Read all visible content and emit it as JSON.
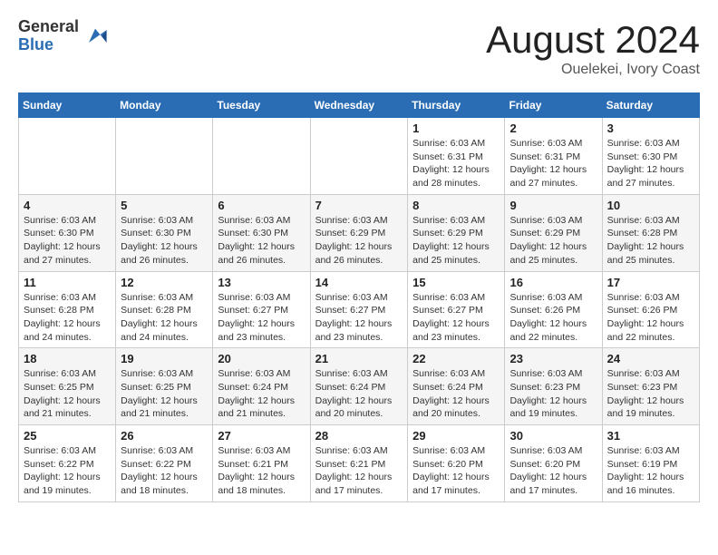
{
  "header": {
    "logo_general": "General",
    "logo_blue": "Blue",
    "month_title": "August 2024",
    "location": "Ouelekei, Ivory Coast"
  },
  "days_of_week": [
    "Sunday",
    "Monday",
    "Tuesday",
    "Wednesday",
    "Thursday",
    "Friday",
    "Saturday"
  ],
  "weeks": [
    [
      {
        "day": "",
        "info": ""
      },
      {
        "day": "",
        "info": ""
      },
      {
        "day": "",
        "info": ""
      },
      {
        "day": "",
        "info": ""
      },
      {
        "day": "1",
        "info": "Sunrise: 6:03 AM\nSunset: 6:31 PM\nDaylight: 12 hours\nand 28 minutes."
      },
      {
        "day": "2",
        "info": "Sunrise: 6:03 AM\nSunset: 6:31 PM\nDaylight: 12 hours\nand 27 minutes."
      },
      {
        "day": "3",
        "info": "Sunrise: 6:03 AM\nSunset: 6:30 PM\nDaylight: 12 hours\nand 27 minutes."
      }
    ],
    [
      {
        "day": "4",
        "info": "Sunrise: 6:03 AM\nSunset: 6:30 PM\nDaylight: 12 hours\nand 27 minutes."
      },
      {
        "day": "5",
        "info": "Sunrise: 6:03 AM\nSunset: 6:30 PM\nDaylight: 12 hours\nand 26 minutes."
      },
      {
        "day": "6",
        "info": "Sunrise: 6:03 AM\nSunset: 6:30 PM\nDaylight: 12 hours\nand 26 minutes."
      },
      {
        "day": "7",
        "info": "Sunrise: 6:03 AM\nSunset: 6:29 PM\nDaylight: 12 hours\nand 26 minutes."
      },
      {
        "day": "8",
        "info": "Sunrise: 6:03 AM\nSunset: 6:29 PM\nDaylight: 12 hours\nand 25 minutes."
      },
      {
        "day": "9",
        "info": "Sunrise: 6:03 AM\nSunset: 6:29 PM\nDaylight: 12 hours\nand 25 minutes."
      },
      {
        "day": "10",
        "info": "Sunrise: 6:03 AM\nSunset: 6:28 PM\nDaylight: 12 hours\nand 25 minutes."
      }
    ],
    [
      {
        "day": "11",
        "info": "Sunrise: 6:03 AM\nSunset: 6:28 PM\nDaylight: 12 hours\nand 24 minutes."
      },
      {
        "day": "12",
        "info": "Sunrise: 6:03 AM\nSunset: 6:28 PM\nDaylight: 12 hours\nand 24 minutes."
      },
      {
        "day": "13",
        "info": "Sunrise: 6:03 AM\nSunset: 6:27 PM\nDaylight: 12 hours\nand 23 minutes."
      },
      {
        "day": "14",
        "info": "Sunrise: 6:03 AM\nSunset: 6:27 PM\nDaylight: 12 hours\nand 23 minutes."
      },
      {
        "day": "15",
        "info": "Sunrise: 6:03 AM\nSunset: 6:27 PM\nDaylight: 12 hours\nand 23 minutes."
      },
      {
        "day": "16",
        "info": "Sunrise: 6:03 AM\nSunset: 6:26 PM\nDaylight: 12 hours\nand 22 minutes."
      },
      {
        "day": "17",
        "info": "Sunrise: 6:03 AM\nSunset: 6:26 PM\nDaylight: 12 hours\nand 22 minutes."
      }
    ],
    [
      {
        "day": "18",
        "info": "Sunrise: 6:03 AM\nSunset: 6:25 PM\nDaylight: 12 hours\nand 21 minutes."
      },
      {
        "day": "19",
        "info": "Sunrise: 6:03 AM\nSunset: 6:25 PM\nDaylight: 12 hours\nand 21 minutes."
      },
      {
        "day": "20",
        "info": "Sunrise: 6:03 AM\nSunset: 6:24 PM\nDaylight: 12 hours\nand 21 minutes."
      },
      {
        "day": "21",
        "info": "Sunrise: 6:03 AM\nSunset: 6:24 PM\nDaylight: 12 hours\nand 20 minutes."
      },
      {
        "day": "22",
        "info": "Sunrise: 6:03 AM\nSunset: 6:24 PM\nDaylight: 12 hours\nand 20 minutes."
      },
      {
        "day": "23",
        "info": "Sunrise: 6:03 AM\nSunset: 6:23 PM\nDaylight: 12 hours\nand 19 minutes."
      },
      {
        "day": "24",
        "info": "Sunrise: 6:03 AM\nSunset: 6:23 PM\nDaylight: 12 hours\nand 19 minutes."
      }
    ],
    [
      {
        "day": "25",
        "info": "Sunrise: 6:03 AM\nSunset: 6:22 PM\nDaylight: 12 hours\nand 19 minutes."
      },
      {
        "day": "26",
        "info": "Sunrise: 6:03 AM\nSunset: 6:22 PM\nDaylight: 12 hours\nand 18 minutes."
      },
      {
        "day": "27",
        "info": "Sunrise: 6:03 AM\nSunset: 6:21 PM\nDaylight: 12 hours\nand 18 minutes."
      },
      {
        "day": "28",
        "info": "Sunrise: 6:03 AM\nSunset: 6:21 PM\nDaylight: 12 hours\nand 17 minutes."
      },
      {
        "day": "29",
        "info": "Sunrise: 6:03 AM\nSunset: 6:20 PM\nDaylight: 12 hours\nand 17 minutes."
      },
      {
        "day": "30",
        "info": "Sunrise: 6:03 AM\nSunset: 6:20 PM\nDaylight: 12 hours\nand 17 minutes."
      },
      {
        "day": "31",
        "info": "Sunrise: 6:03 AM\nSunset: 6:19 PM\nDaylight: 12 hours\nand 16 minutes."
      }
    ]
  ]
}
